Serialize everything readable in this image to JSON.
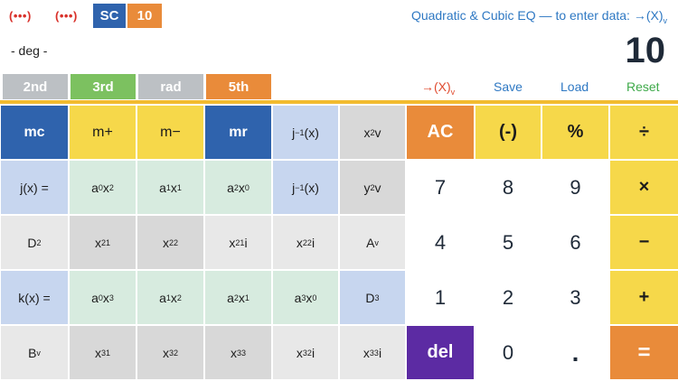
{
  "topbar": {
    "dots1": "(•••)",
    "dots2": "(•••)",
    "sc": "SC",
    "base": "10",
    "hint_prefix": "Quadratic & Cubic EQ — to enter data: →(X)",
    "hint_sub": "v"
  },
  "display": {
    "mode": "- deg -",
    "value": "10"
  },
  "modes": {
    "second": "2nd",
    "third": "3rd",
    "rad": "rad",
    "fifth": "5th"
  },
  "actions": {
    "x_prefix": "→(X)",
    "x_sub": "v",
    "save": "Save",
    "load": "Load",
    "reset": "Reset"
  },
  "keys": {
    "mc": "mc",
    "mplus": "m+",
    "mminus": "m−",
    "mr": "mr",
    "jinv_x_a": "j",
    "jinv_x_b": "−1",
    "jinv_x_c": "(x)",
    "x2v_a": "x",
    "x2v_b": "2",
    "x2v_c": "v",
    "ac": "AC",
    "neg": "(-)",
    "pct": "%",
    "div": "÷",
    "jx": "j(x) =",
    "a0x2_a": "a",
    "a0x2_b": "0",
    "a0x2_c": "x",
    "a0x2_d": "2",
    "a1x1_a": "a",
    "a1x1_b": "1",
    "a1x1_c": "x",
    "a1x1_d": "1",
    "a2x0_a": "a",
    "a2x0_b": "2",
    "a2x0_c": "x",
    "a2x0_d": "0",
    "jinv2_a": "j",
    "jinv2_b": "−1",
    "jinv2_c": "(x)",
    "y2v_a": "y",
    "y2v_b": "2",
    "y2v_c": "v",
    "n7": "7",
    "n8": "8",
    "n9": "9",
    "mul": "×",
    "d2_a": "D",
    "d2_b": "2",
    "x21_a": "x",
    "x21_b": "21",
    "x22_a": "x",
    "x22_b": "22",
    "x21i_a": "x",
    "x21i_b": "21",
    "x21i_c": "i",
    "x22i_a": "x",
    "x22i_b": "22",
    "x22i_c": "i",
    "av_a": "A",
    "av_b": "v",
    "n4": "4",
    "n5": "5",
    "n6": "6",
    "sub": "−",
    "kx": "k(x) =",
    "a0x3_a": "a",
    "a0x3_b": "0",
    "a0x3_c": "x",
    "a0x3_d": "3",
    "a1x2_a": "a",
    "a1x2_b": "1",
    "a1x2_c": "x",
    "a1x2_d": "2",
    "a2x1_a": "a",
    "a2x1_b": "2",
    "a2x1_c": "x",
    "a2x1_d": "1",
    "a3x0_a": "a",
    "a3x0_b": "3",
    "a3x0_c": "x",
    "a3x0_d": "0",
    "d3_a": "D",
    "d3_b": "3",
    "n1": "1",
    "n2": "2",
    "n3": "3",
    "add": "+",
    "bv_a": "B",
    "bv_b": "v",
    "x31_a": "x",
    "x31_b": "31",
    "x32_a": "x",
    "x32_b": "32",
    "x33_a": "x",
    "x33_b": "33",
    "x32i_a": "x",
    "x32i_b": "32",
    "x32i_c": "i",
    "x33i_a": "x",
    "x33i_b": "33",
    "x33i_c": "i",
    "del": "del",
    "n0": "0",
    "dot": ".",
    "eq": "="
  }
}
